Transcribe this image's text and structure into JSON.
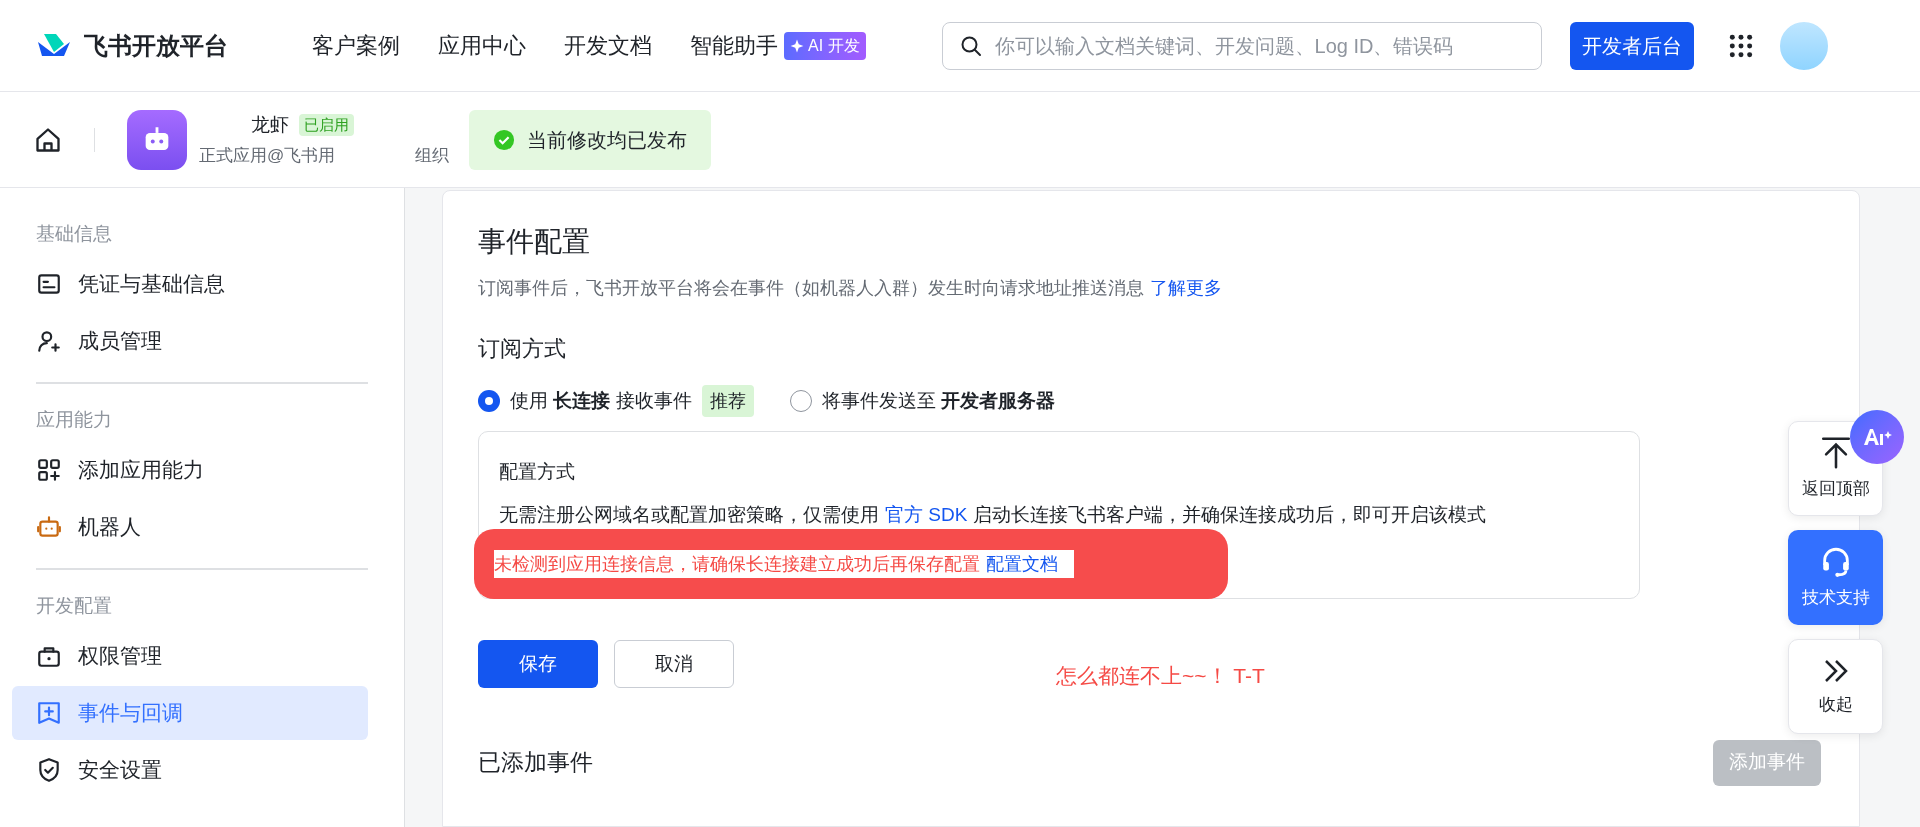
{
  "header": {
    "logo_text": "飞书开放平台",
    "nav": [
      {
        "label": "客户案例"
      },
      {
        "label": "应用中心"
      },
      {
        "label": "开发文档"
      },
      {
        "label": "智能助手"
      }
    ],
    "ai_badge": "AI 开发",
    "search": {
      "placeholder": "你可以输入文档关键词、开发问题、Log ID、错误码"
    },
    "console_button": "开发者后台"
  },
  "app_bar": {
    "app_name": "龙虾",
    "status_badge": "已启用",
    "subtitle_parts": [
      "正式应用@飞书用",
      "组织"
    ],
    "toast": "当前修改均已发布"
  },
  "sidebar": {
    "sections": [
      {
        "title": "基础信息",
        "items": [
          {
            "label": "凭证与基础信息",
            "selected": false
          },
          {
            "label": "成员管理",
            "selected": false
          }
        ]
      },
      {
        "title": "应用能力",
        "items": [
          {
            "label": "添加应用能力",
            "selected": false
          },
          {
            "label": "机器人",
            "selected": false
          }
        ]
      },
      {
        "title": "开发配置",
        "items": [
          {
            "label": "权限管理",
            "selected": false
          },
          {
            "label": "事件与回调",
            "selected": true
          },
          {
            "label": "安全设置",
            "selected": false
          }
        ]
      }
    ]
  },
  "main": {
    "title": "事件配置",
    "description": "订阅事件后，飞书开放平台将会在事件（如机器人入群）发生时向请求地址推送消息",
    "learn_more": "了解更多",
    "subscription": {
      "title": "订阅方式",
      "options": [
        {
          "label": "使用 **长连接** 接收事件",
          "badge": "推荐",
          "selected": true
        },
        {
          "label": "将事件发送至 **开发者服务器**",
          "selected": false
        }
      ]
    },
    "config_box": {
      "title": "配置方式",
      "text_before": "无需注册公网域名或配置加密策略，仅需使用",
      "sdk_link": "官方 SDK",
      "text_after": "启动长连接飞书客户端，并确保连接成功后，即可开启该模式",
      "error": "未检测到应用连接信息，请确保长连接建立成功后再保存配置",
      "doc_link": "配置文档"
    },
    "buttons": [
      {
        "label": "保存",
        "kind": "primary"
      },
      {
        "label": "取消",
        "kind": "secondary"
      }
    ],
    "annotation": "怎么都连不上~~！ T-T",
    "added_events": {
      "title": "已添加事件",
      "add_button": {
        "label": "添加事件",
        "disabled": true
      }
    }
  },
  "float_buttons": [
    {
      "label": "返回顶部",
      "selected": false
    },
    {
      "label": "技术支持",
      "selected": true
    },
    {
      "label": "收起",
      "selected": false
    }
  ]
}
